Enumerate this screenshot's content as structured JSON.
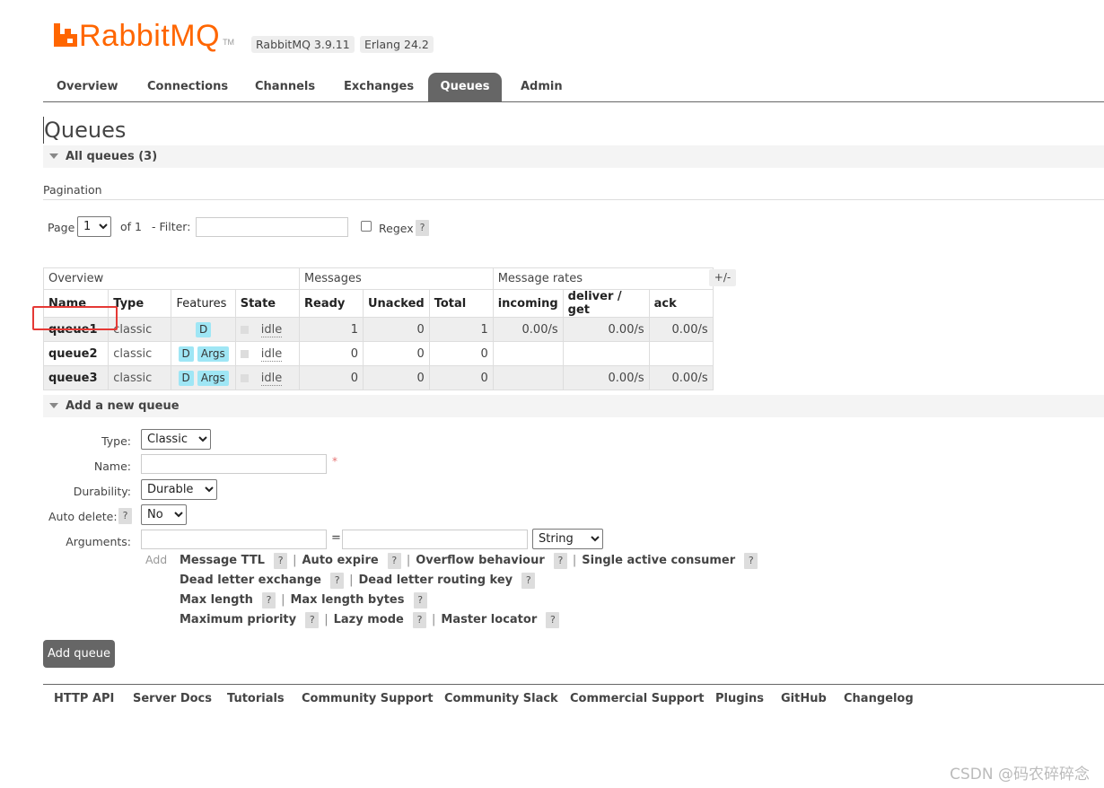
{
  "header": {
    "logo_text": "RabbitMQ",
    "logo_tm": "TM",
    "version": "RabbitMQ 3.9.11",
    "erlang": "Erlang 24.2"
  },
  "nav": {
    "tabs": [
      "Overview",
      "Connections",
      "Channels",
      "Exchanges",
      "Queues",
      "Admin"
    ],
    "active": "Queues"
  },
  "page": {
    "title": "Queues",
    "all_queues": "All queues (3)"
  },
  "pagination": {
    "label": "Pagination",
    "page_label": "Page",
    "page_value": "1",
    "of_label": "of 1",
    "filter_label": "- Filter:",
    "filter_value": "",
    "regex_label": "Regex",
    "help": "?"
  },
  "table": {
    "groups": [
      "Overview",
      "Messages",
      "Message rates"
    ],
    "toggle": "+/-",
    "columns": [
      "Name",
      "Type",
      "Features",
      "State",
      "Ready",
      "Unacked",
      "Total",
      "incoming",
      "deliver / get",
      "ack"
    ],
    "rows": [
      {
        "name": "queue1",
        "type": "classic",
        "features": [
          "D"
        ],
        "state": "idle",
        "ready": "1",
        "unacked": "0",
        "total": "1",
        "incoming": "0.00/s",
        "deliver_get": "0.00/s",
        "ack": "0.00/s"
      },
      {
        "name": "queue2",
        "type": "classic",
        "features": [
          "D",
          "Args"
        ],
        "state": "idle",
        "ready": "0",
        "unacked": "0",
        "total": "0",
        "incoming": "",
        "deliver_get": "",
        "ack": ""
      },
      {
        "name": "queue3",
        "type": "classic",
        "features": [
          "D",
          "Args"
        ],
        "state": "idle",
        "ready": "0",
        "unacked": "0",
        "total": "0",
        "incoming": "",
        "deliver_get": "0.00/s",
        "ack": "0.00/s"
      }
    ]
  },
  "add_queue": {
    "section": "Add a new queue",
    "type_label": "Type:",
    "type_value": "Classic",
    "name_label": "Name:",
    "name_value": "",
    "required": "*",
    "durability_label": "Durability:",
    "durability_value": "Durable",
    "auto_delete_label": "Auto delete:",
    "auto_delete_value": "No",
    "arguments_label": "Arguments:",
    "equals": "=",
    "arg_type_value": "String",
    "add_link": "Add",
    "arg_shortcuts": [
      [
        "Message TTL",
        "Auto expire",
        "Overflow behaviour",
        "Single active consumer"
      ],
      [
        "Dead letter exchange",
        "Dead letter routing key"
      ],
      [
        "Max length",
        "Max length bytes"
      ],
      [
        "Maximum priority",
        "Lazy mode",
        "Master locator"
      ]
    ],
    "submit": "Add queue"
  },
  "footer": {
    "links": [
      "HTTP API",
      "Server Docs",
      "Tutorials",
      "Community Support",
      "Community Slack",
      "Commercial Support",
      "Plugins",
      "GitHub",
      "Changelog"
    ]
  },
  "watermark": "CSDN @码农碎碎念"
}
